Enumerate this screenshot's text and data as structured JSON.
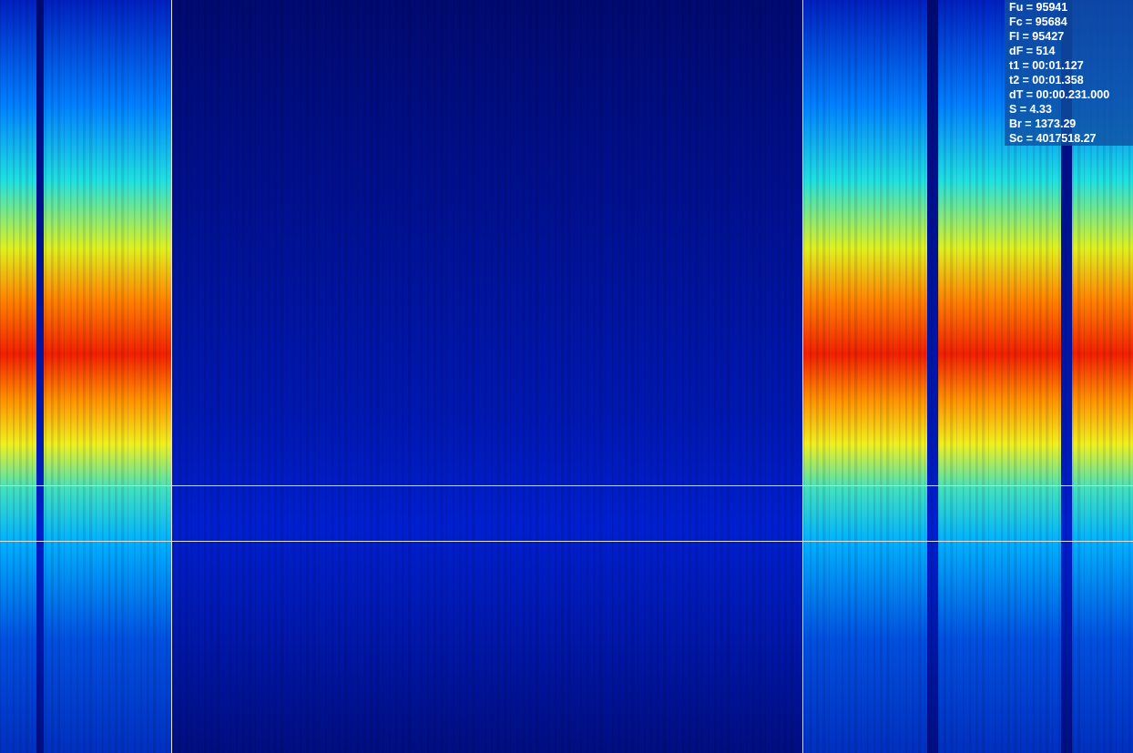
{
  "readout": [
    "Fu = 95941",
    "Fc = 95684",
    "Fl = 95427",
    "dF = 514",
    "t1 = 00:01.127",
    "t2 = 00:01.358",
    "dT = 00:00.231.000",
    "S = 4.33",
    "Br = 1373.29",
    "Sc = 4017518.27"
  ]
}
